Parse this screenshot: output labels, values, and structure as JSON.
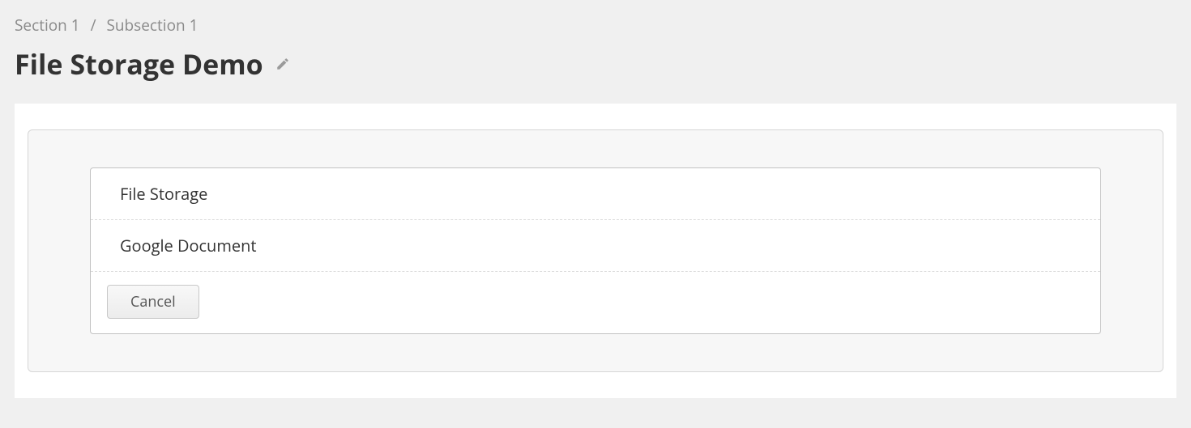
{
  "breadcrumb": {
    "items": [
      "Section 1",
      "Subsection 1"
    ],
    "separator": "/"
  },
  "page": {
    "title": "File Storage Demo"
  },
  "options": [
    {
      "label": "File Storage"
    },
    {
      "label": "Google Document"
    }
  ],
  "actions": {
    "cancel_label": "Cancel"
  }
}
